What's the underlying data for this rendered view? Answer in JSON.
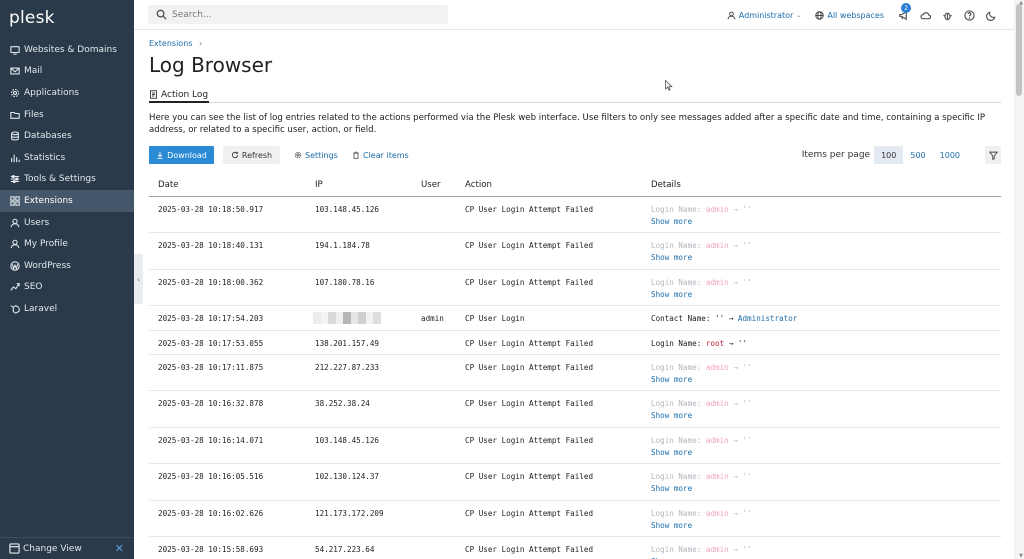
{
  "app": {
    "logo": "plesk"
  },
  "sidebar": {
    "items": [
      {
        "label": "Websites & Domains",
        "icon": "monitor-icon"
      },
      {
        "label": "Mail",
        "icon": "mail-icon"
      },
      {
        "label": "Applications",
        "icon": "gear-icon"
      },
      {
        "label": "Files",
        "icon": "folder-icon"
      },
      {
        "label": "Databases",
        "icon": "database-icon"
      },
      {
        "label": "Statistics",
        "icon": "bar-chart-icon"
      },
      {
        "label": "Tools & Settings",
        "icon": "sliders-icon"
      },
      {
        "label": "Extensions",
        "icon": "grid-icon",
        "active": true
      },
      {
        "label": "Users",
        "icon": "user-icon"
      },
      {
        "label": "My Profile",
        "icon": "profile-icon"
      },
      {
        "label": "WordPress",
        "icon": "wordpress-icon"
      },
      {
        "label": "SEO",
        "icon": "trend-icon"
      },
      {
        "label": "Laravel",
        "icon": "laravel-icon"
      }
    ],
    "change_view": "Change View"
  },
  "header": {
    "search_placeholder": "Search...",
    "user": "Administrator",
    "webspaces": "All webspaces",
    "notifications_count": "2"
  },
  "breadcrumb": "Extensions",
  "page_title": "Log Browser",
  "tab": "Action Log",
  "description": "Here you can see the list of log entries related to the actions performed via the Plesk web interface. Use filters to only see messages added after a specific date and time, containing a specific IP address, or related to a specific user, action, or field.",
  "toolbar": {
    "download": "Download",
    "refresh": "Refresh",
    "settings": "Settings",
    "clear": "Clear items",
    "items_per_page_label": "Items per page",
    "items_per_page_options": [
      "100",
      "500",
      "1000"
    ],
    "items_per_page_selected": "100"
  },
  "table": {
    "columns": [
      "Date",
      "IP",
      "User",
      "Action",
      "Details"
    ],
    "show_more": "Show more",
    "rows": [
      {
        "date": "2025-03-28 10:18:50.917",
        "ip": "103.148.45.126",
        "user": "",
        "action": "CP User Login Attempt Failed",
        "d_label": "Login Name:",
        "d_old": "admin",
        "d_arrow": "→",
        "d_new": "''",
        "style": "muted",
        "show_more": true
      },
      {
        "date": "2025-03-28 10:18:40.131",
        "ip": "194.1.184.78",
        "user": "",
        "action": "CP User Login Attempt Failed",
        "d_label": "Login Name:",
        "d_old": "admin",
        "d_arrow": "→",
        "d_new": "''",
        "style": "muted",
        "show_more": true
      },
      {
        "date": "2025-03-28 10:18:00.362",
        "ip": "107.180.78.16",
        "user": "",
        "action": "CP User Login Attempt Failed",
        "d_label": "Login Name:",
        "d_old": "admin",
        "d_arrow": "→",
        "d_new": "''",
        "style": "muted",
        "show_more": true
      },
      {
        "date": "2025-03-28 10:17:54.203",
        "ip": "",
        "user": "admin",
        "action": "CP User Login",
        "d_label": "Contact Name:",
        "d_old": "''",
        "d_arrow": "→",
        "d_new": "Administrator",
        "style": "contact",
        "show_more": false
      },
      {
        "date": "2025-03-28 10:17:53.055",
        "ip": "138.201.157.49",
        "user": "",
        "action": "CP User Login Attempt Failed",
        "d_label": "Login Name:",
        "d_old": "root",
        "d_arrow": "→",
        "d_new": "''",
        "style": "strong",
        "show_more": false
      },
      {
        "date": "2025-03-28 10:17:11.875",
        "ip": "212.227.87.233",
        "user": "",
        "action": "CP User Login Attempt Failed",
        "d_label": "Login Name:",
        "d_old": "admin",
        "d_arrow": "→",
        "d_new": "''",
        "style": "muted",
        "show_more": true
      },
      {
        "date": "2025-03-28 10:16:32.878",
        "ip": "38.252.38.24",
        "user": "",
        "action": "CP User Login Attempt Failed",
        "d_label": "Login Name:",
        "d_old": "admin",
        "d_arrow": "→",
        "d_new": "''",
        "style": "muted",
        "show_more": true
      },
      {
        "date": "2025-03-28 10:16:14.071",
        "ip": "103.148.45.126",
        "user": "",
        "action": "CP User Login Attempt Failed",
        "d_label": "Login Name:",
        "d_old": "admin",
        "d_arrow": "→",
        "d_new": "''",
        "style": "muted",
        "show_more": true
      },
      {
        "date": "2025-03-28 10:16:05.516",
        "ip": "102.130.124.37",
        "user": "",
        "action": "CP User Login Attempt Failed",
        "d_label": "Login Name:",
        "d_old": "admin",
        "d_arrow": "→",
        "d_new": "''",
        "style": "muted",
        "show_more": true
      },
      {
        "date": "2025-03-28 10:16:02.626",
        "ip": "121.173.172.209",
        "user": "",
        "action": "CP User Login Attempt Failed",
        "d_label": "Login Name:",
        "d_old": "admin",
        "d_arrow": "→",
        "d_new": "''",
        "style": "muted",
        "show_more": true
      },
      {
        "date": "2025-03-28 10:15:58.693",
        "ip": "54.217.223.64",
        "user": "",
        "action": "CP User Login Attempt Failed",
        "d_label": "Login Name:",
        "d_old": "admin",
        "d_arrow": "→",
        "d_new": "''",
        "style": "muted",
        "show_more": true
      }
    ]
  }
}
